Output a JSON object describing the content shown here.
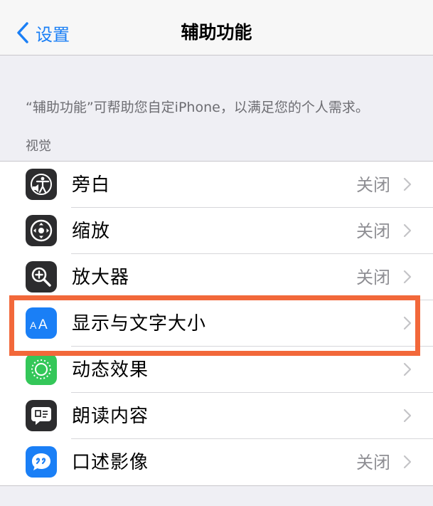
{
  "nav": {
    "back_label": "设置",
    "title": "辅助功能"
  },
  "description": "“辅助功能”可帮助您自定iPhone，以满足您的个人需求。",
  "section": {
    "header": "视觉"
  },
  "items": [
    {
      "label": "旁白",
      "value": "关闭",
      "icon": "voiceover-icon",
      "icon_bg": "#2c2c2e"
    },
    {
      "label": "缩放",
      "value": "关闭",
      "icon": "zoom-icon",
      "icon_bg": "#2c2c2e"
    },
    {
      "label": "放大器",
      "value": "关闭",
      "icon": "magnifier-icon",
      "icon_bg": "#2c2c2e"
    },
    {
      "label": "显示与文字大小",
      "value": "",
      "icon": "text-size-icon",
      "icon_bg": "#1a7ff6"
    },
    {
      "label": "动态效果",
      "value": "",
      "icon": "motion-icon",
      "icon_bg": "#34c759"
    },
    {
      "label": "朗读内容",
      "value": "",
      "icon": "spoken-content-icon",
      "icon_bg": "#2c2c2e"
    },
    {
      "label": "口述影像",
      "value": "关闭",
      "icon": "audio-descriptions-icon",
      "icon_bg": "#1a7ff6"
    }
  ],
  "highlight_color": "#f2683a"
}
